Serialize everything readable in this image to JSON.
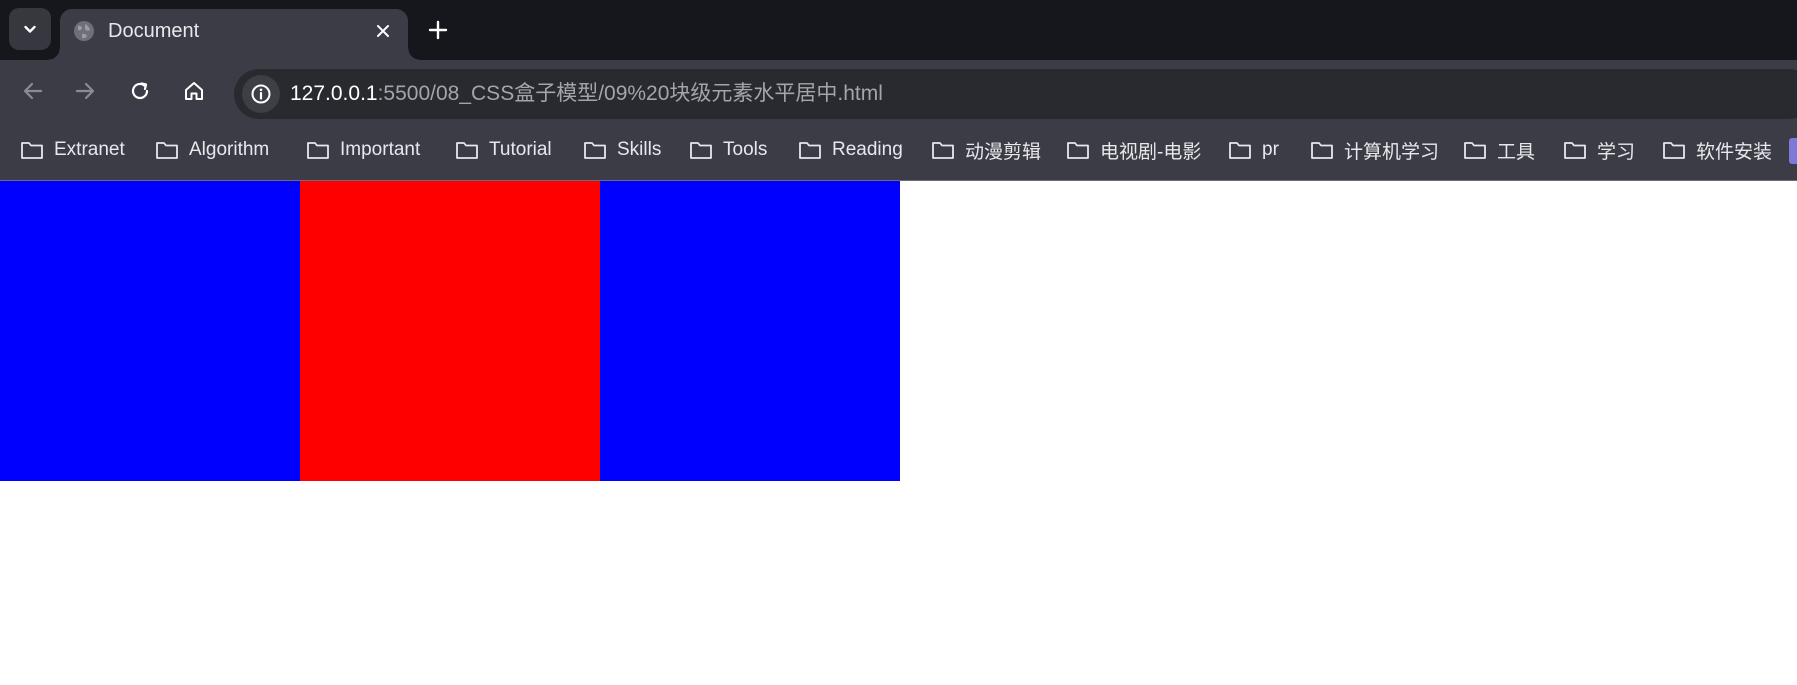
{
  "tab": {
    "title": "Document"
  },
  "address_bar": {
    "host": "127.0.0.1",
    "path": ":5500/08_CSS盒子模型/09%20块级元素水平居中.html"
  },
  "bookmarks": [
    "Extranet",
    "Algorithm",
    "Important",
    "Tutorial",
    "Skills",
    "Tools",
    "Reading",
    "动漫剪辑",
    "电视剧-电影",
    "pr",
    "计算机学习",
    "工具",
    "学习",
    "软件安装"
  ],
  "page": {
    "boxes": [
      {
        "name": "left-box",
        "color": "#0000ff"
      },
      {
        "name": "center-box",
        "color": "#ff0000"
      },
      {
        "name": "right-box",
        "color": "#0000ff"
      }
    ]
  },
  "colors": {
    "tabstrip_bg": "#16171c",
    "toolbar_bg": "#3b3c45",
    "omnibox_bg": "#292a30"
  }
}
